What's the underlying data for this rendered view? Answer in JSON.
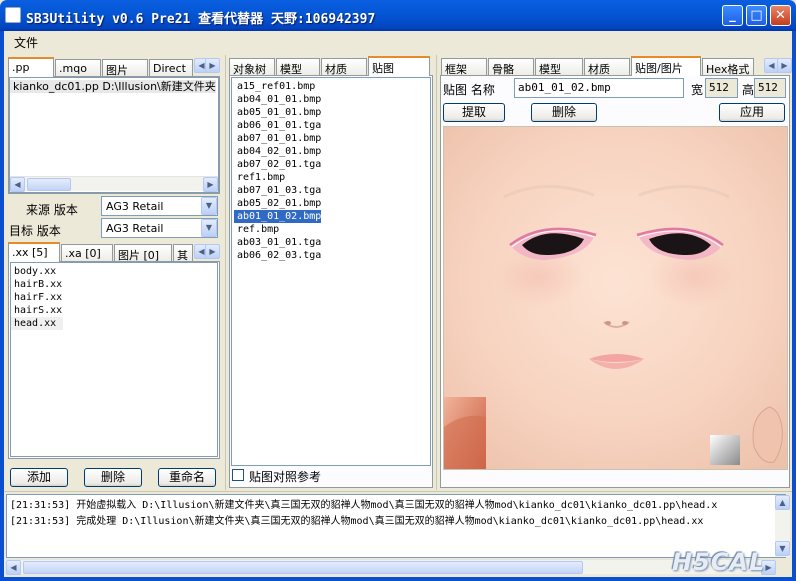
{
  "window": {
    "title": "SB3Utility v0.6 Pre21 查看代替器 天野:106942397"
  },
  "menu": {
    "file": "文件"
  },
  "left": {
    "tabs": [
      ".pp",
      ".mqo",
      "图片",
      "Direct"
    ],
    "pp_list": [
      {
        "name": "kianko_dc01.pp",
        "path": "D:\\Illusion\\新建文件夹\\"
      }
    ],
    "source_label": "来源 版本",
    "source_value": "AG3 Retail",
    "target_label": "目标 版本",
    "target_value": "AG3 Retail",
    "tabs2": [
      ".xx [5]",
      ".xa [0]",
      "图片 [0]",
      "其"
    ],
    "xx_files": [
      "body.xx",
      "hairB.xx",
      "hairF.xx",
      "hairS.xx",
      "head.xx"
    ],
    "buttons": {
      "add": "添加",
      "delete": "删除",
      "rename": "重命名"
    }
  },
  "middle": {
    "tabs": [
      "对象树",
      "模型",
      "材质",
      "贴图"
    ],
    "textures": [
      "a15_ref01.bmp",
      "ab04_01_01.bmp",
      "ab05_01_01.bmp",
      "ab06_01_01.tga",
      "ab07_01_01.bmp",
      "ab04_02_01.bmp",
      "ab07_02_01.tga",
      "ref1.bmp",
      "ab07_01_03.tga",
      "ab05_02_01.bmp",
      "ab01_01_02.bmp",
      "ref.bmp",
      "ab03_01_01.tga",
      "ab06_02_03.tga"
    ],
    "selected_index": 10,
    "checkbox_label": "贴图对照参考"
  },
  "right": {
    "tabs": [
      "框架",
      "骨骼",
      "模型",
      "材质",
      "贴图/图片",
      "Hex格式"
    ],
    "name_label": "贴图 名称",
    "name_value": "ab01_01_02.bmp",
    "width_label": "宽",
    "width_value": "512",
    "height_label": "高",
    "height_value": "512",
    "extract": "提取",
    "delete": "删除",
    "apply": "应用"
  },
  "log": {
    "lines": [
      "[21:31:53] 开始虚拟载入 D:\\Illusion\\新建文件夹\\真三国无双的貂禅人物mod\\真三国无双的貂禅人物mod\\kianko_dc01\\kianko_dc01.pp\\head.x",
      "[21:31:53] 完成处理 D:\\Illusion\\新建文件夹\\真三国无双的貂禅人物mod\\真三国无双的貂禅人物mod\\kianko_dc01\\kianko_dc01.pp\\head.xx"
    ]
  },
  "watermark": "H5CAL",
  "icons": {
    "minimize": "minimize-icon",
    "maximize": "maximize-icon",
    "close": "close-icon"
  }
}
